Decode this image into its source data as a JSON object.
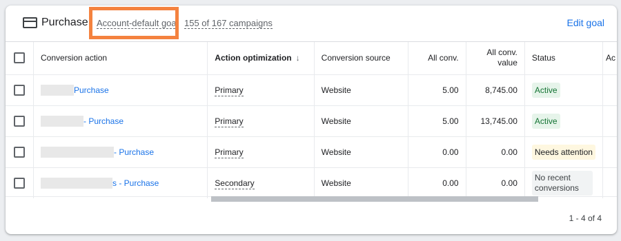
{
  "header": {
    "title": "Purchase",
    "goal_link": "Account-default goal",
    "campaigns": "155 of 167 campaigns",
    "edit_goal": "Edit goal"
  },
  "table": {
    "columns": {
      "conversion_action": "Conversion action",
      "action_optimization": "Action optimization",
      "conversion_source": "Conversion source",
      "all_conv": "All conv.",
      "all_conv_value": "All conv. value",
      "status": "Status",
      "overflow": "Ac"
    },
    "rows": [
      {
        "action": "Purchase",
        "optimization": "Primary",
        "source": "Website",
        "all_conv": "5.00",
        "value": "8,745.00",
        "status": "Active"
      },
      {
        "action": "- Purchase",
        "optimization": "Primary",
        "source": "Website",
        "all_conv": "5.00",
        "value": "13,745.00",
        "status": "Active"
      },
      {
        "action": "- Purchase",
        "optimization": "Primary",
        "source": "Website",
        "all_conv": "0.00",
        "value": "0.00",
        "status": "Needs attention"
      },
      {
        "action": "s - Purchase",
        "optimization": "Secondary",
        "source": "Website",
        "all_conv": "0.00",
        "value": "0.00",
        "status": "No recent conversions"
      }
    ]
  },
  "pagination": "1 - 4 of 4",
  "colors": {
    "link": "#1a73e8",
    "highlight": "#f4823f",
    "active_bg": "#e6f4ea",
    "attention_bg": "#fef7e0"
  }
}
